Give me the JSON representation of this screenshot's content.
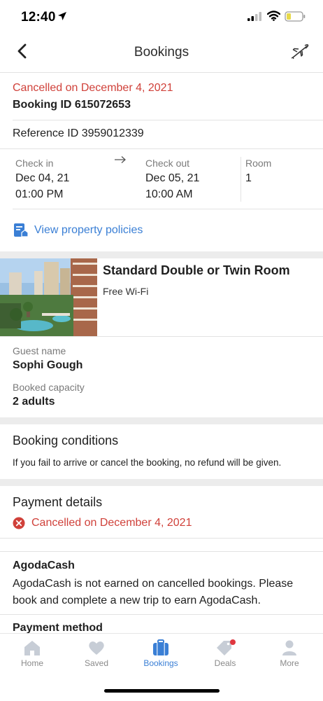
{
  "status_bar": {
    "time": "12:40"
  },
  "header": {
    "title": "Bookings",
    "back_icon": "chevron-left-icon",
    "action_icon": "airplane-icon"
  },
  "booking": {
    "status_text": "Cancelled on December 4, 2021",
    "booking_id": "Booking ID 615072653",
    "reference_id": "Reference ID 3959012339",
    "check_in": {
      "label": "Check in",
      "date": "Dec 04, 21",
      "time": "01:00 PM"
    },
    "check_out": {
      "label": "Check out",
      "date": "Dec 05, 21",
      "time": "10:00 AM"
    },
    "room": {
      "label": "Room",
      "value": "1"
    },
    "policy_link": "View property policies"
  },
  "room_info": {
    "name": "Standard Double or Twin Room",
    "amenity": "Free Wi-Fi"
  },
  "guest": {
    "name_label": "Guest name",
    "name": "Sophi Gough",
    "capacity_label": "Booked capacity",
    "capacity": "2 adults"
  },
  "conditions": {
    "title": "Booking conditions",
    "text": "If you fail to arrive or cancel the booking, no refund will be given."
  },
  "payment": {
    "title": "Payment details",
    "status": "Cancelled on December 4, 2021",
    "agoda_title": "AgodaCash",
    "agoda_text": "AgodaCash is not earned on cancelled bookings. Please book and complete a new trip to earn AgodaCash.",
    "method_title": "Payment method"
  },
  "tabs": [
    {
      "label": "Home",
      "icon": "home-icon",
      "active": false
    },
    {
      "label": "Saved",
      "icon": "heart-icon",
      "active": false
    },
    {
      "label": "Bookings",
      "icon": "suitcase-icon",
      "active": true
    },
    {
      "label": "Deals",
      "icon": "tag-icon",
      "active": false
    },
    {
      "label": "More",
      "icon": "person-icon",
      "active": false
    }
  ],
  "colors": {
    "accent": "#3a7fd5",
    "cancel": "#d0413a",
    "divider": "#ececec"
  }
}
